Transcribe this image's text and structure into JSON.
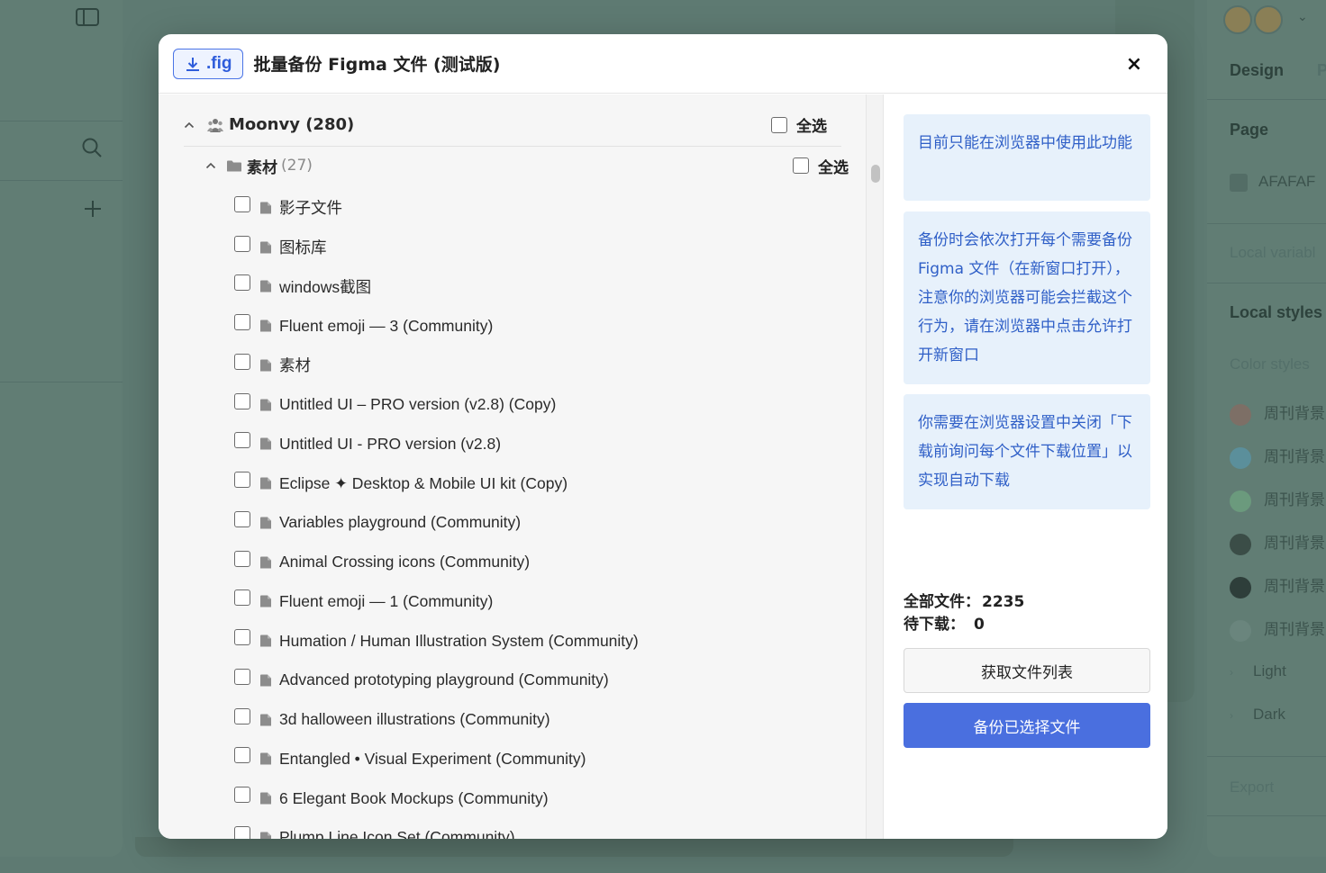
{
  "background": {
    "right_panel": {
      "tab_design": "Design",
      "tab_prototype": "P",
      "section_page": "Page",
      "page_color": "AFAFAF",
      "local_variables": "Local variabl",
      "local_styles": "Local styles",
      "color_styles": "Color styles",
      "style_items": [
        {
          "label": "周刊背景",
          "color": "#7d6f66"
        },
        {
          "label": "周刊背景",
          "color": "#5b8f9b"
        },
        {
          "label": "周刊背景",
          "color": "#6b9a7d"
        },
        {
          "label": "周刊背景",
          "color": "#3b4d47"
        },
        {
          "label": "周刊背景",
          "color": "#2e3e3a"
        },
        {
          "label": "周刊背景",
          "color": "#6a857d"
        }
      ],
      "groups": [
        "Light",
        "Dark"
      ],
      "export": "Export"
    }
  },
  "modal": {
    "badge": ".fig",
    "title": "批量备份 Figma 文件 (测试版)",
    "close": "×",
    "team": {
      "name": "Moonvy (280)",
      "select_all": "全选"
    },
    "project": {
      "name": "素材",
      "count": "(27)",
      "select_all": "全选"
    },
    "files": [
      "影子文件",
      "图标库",
      "windows截图",
      "Fluent emoji — 3 (Community)",
      "素材",
      "Untitled UI – PRO version (v2.8) (Copy)",
      "Untitled UI - PRO version (v2.8)",
      "Eclipse ✦ Desktop & Mobile UI kit (Copy)",
      "Variables playground (Community)",
      "Animal Crossing icons (Community)",
      "Fluent emoji — 1 (Community)",
      "Humation / Human Illustration System (Community)",
      "Advanced prototyping playground (Community)",
      "3d halloween illustrations (Community)",
      "Entangled • Visual Experiment (Community)",
      "6 Elegant Book Mockups (Community)",
      "Plump Line Icon Set (Community)"
    ],
    "info": {
      "notice_browser": "目前只能在浏览器中使用此功能",
      "notice_popup": "备份时会依次打开每个需要备份 Figma 文件（在新窗口打开），注意你的浏览器可能会拦截这个行为，请在浏览器中点击允许打开新窗口",
      "notice_download": "你需要在浏览器设置中关闭「下载前询问每个文件下载位置」以实现自动下载"
    },
    "stats": {
      "total_label": "全部文件：",
      "total_value": "2235",
      "pending_label": "待下载：",
      "pending_value": "0"
    },
    "buttons": {
      "fetch": "获取文件列表",
      "backup": "备份已选择文件"
    },
    "colors": {
      "accent": "#4a6fdf",
      "info_bg": "#e7f1fb",
      "info_text": "#2f5fc7"
    }
  }
}
